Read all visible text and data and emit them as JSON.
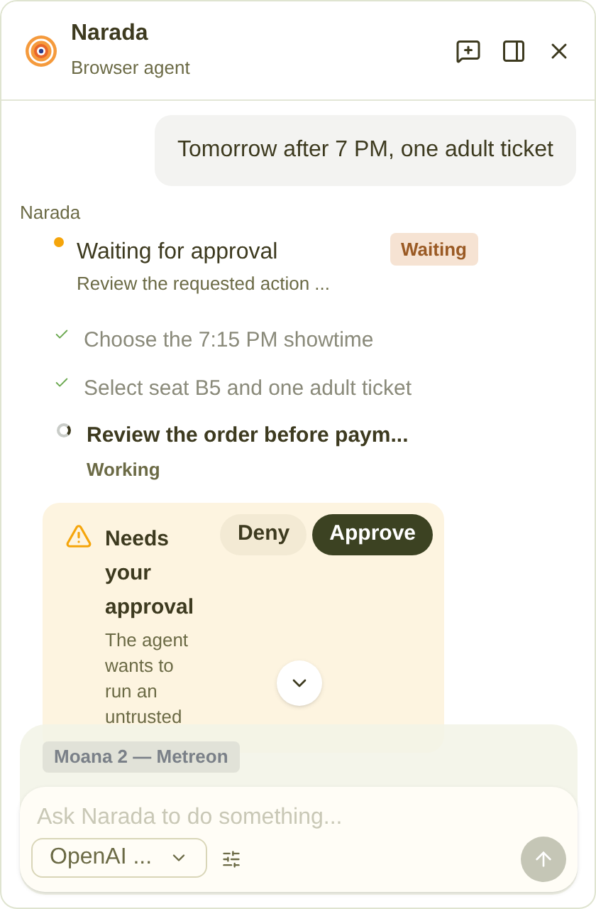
{
  "header": {
    "title": "Narada",
    "subtitle": "Browser agent"
  },
  "messages": [
    {
      "text": "Tomorrow after 7 PM, one adult ticket"
    }
  ],
  "agent": {
    "name": "Narada"
  },
  "status": {
    "title": "Waiting for approval",
    "detail": "Review the requested action ...",
    "badge": "Waiting"
  },
  "steps": [
    {
      "text": "Choose the 7:15 PM showtime",
      "kind": "done"
    },
    {
      "text": "Select seat B5 and one adult ticket",
      "kind": "done"
    },
    {
      "text": "Review the order before paym...",
      "kind": "active",
      "status": "Working"
    }
  ],
  "approval": {
    "title": "Needs your approval",
    "description": "The agent wants to run an untrusted",
    "deny": "Deny",
    "approve": "Approve"
  },
  "composer": {
    "context_chip": "Moana 2 — Metreon",
    "placeholder": "Ask Narada to do something...",
    "model": "OpenAI ...",
    "send_disabled": true
  }
}
